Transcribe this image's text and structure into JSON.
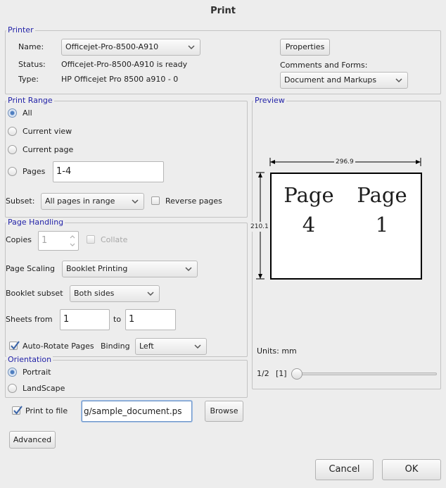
{
  "window": {
    "title": "Print"
  },
  "printer": {
    "legend": "Printer",
    "name_label": "Name:",
    "name_value": "Officejet-Pro-8500-A910",
    "status_label": "Status:",
    "status_value": "Officejet-Pro-8500-A910 is ready",
    "type_label": "Type:",
    "type_value": "HP Officejet Pro 8500 a910 -  0",
    "properties_button": "Properties",
    "comments_label": "Comments and Forms:",
    "comments_value": "Document and Markups"
  },
  "print_range": {
    "legend": "Print Range",
    "all": "All",
    "current_view": "Current view",
    "current_page": "Current page",
    "pages": "Pages",
    "pages_value": "1-4",
    "subset_label": "Subset:",
    "subset_value": "All pages in range",
    "reverse_pages": "Reverse pages",
    "selected": "All"
  },
  "page_handling": {
    "legend": "Page Handling",
    "copies_label": "Copies",
    "copies_value": "1",
    "collate": "Collate",
    "scaling_label": "Page Scaling",
    "scaling_value": "Booklet Printing",
    "booklet_label": "Booklet subset",
    "booklet_value": "Both sides",
    "sheets_from_label": "Sheets from",
    "sheets_from_value": "1",
    "to_label": "to",
    "sheets_to_value": "1",
    "auto_rotate": "Auto-Rotate Pages",
    "auto_rotate_checked": true,
    "binding_label": "Binding",
    "binding_value": "Left"
  },
  "orientation": {
    "legend": "Orientation",
    "portrait": "Portrait",
    "landscape": "LandScape",
    "selected": "Portrait"
  },
  "print_to_file": {
    "label": "Print to file",
    "checked": true,
    "path_value": "g/sample_document.ps",
    "browse_button": "Browse"
  },
  "preview": {
    "legend": "Preview",
    "width_dim": "296.9",
    "height_dim": "210.1",
    "left_page_word": "Page",
    "left_page_number": "4",
    "right_page_word": "Page",
    "right_page_number": "1",
    "units": "Units: mm",
    "page_counter": "1/2",
    "page_indicator": "[1]"
  },
  "buttons": {
    "advanced": "Advanced",
    "cancel": "Cancel",
    "ok": "OK"
  }
}
